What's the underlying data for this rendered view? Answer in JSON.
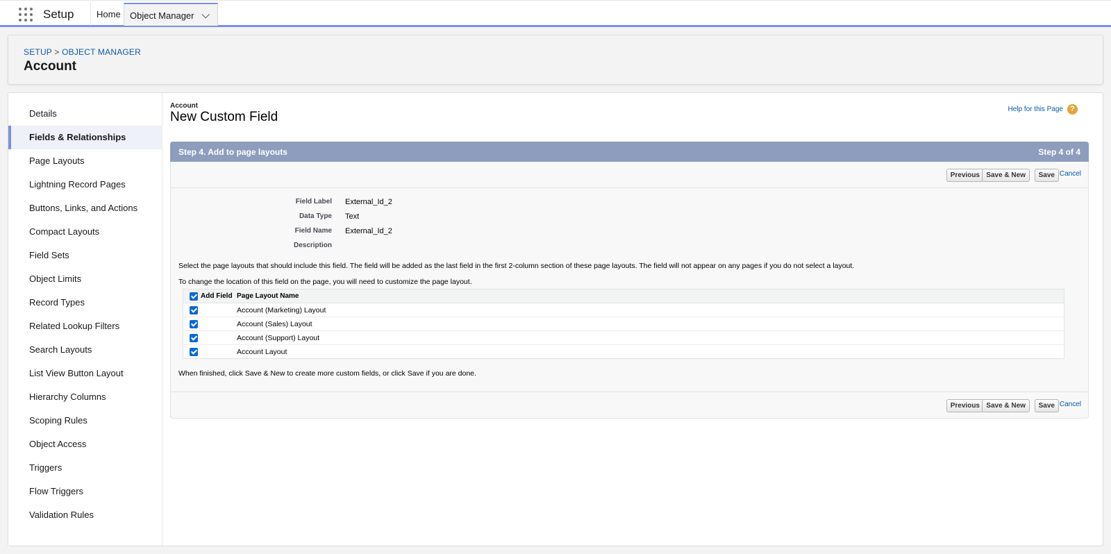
{
  "topnav": {
    "app_name": "Setup",
    "tabs": [
      {
        "label": "Home"
      },
      {
        "label": "Object Manager"
      }
    ]
  },
  "header": {
    "breadcrumb_setup": "SETUP",
    "breadcrumb_sep": " > ",
    "breadcrumb_om": "OBJECT MANAGER",
    "title": "Account"
  },
  "sidebar": {
    "items": [
      {
        "label": "Details"
      },
      {
        "label": "Fields & Relationships"
      },
      {
        "label": "Page Layouts"
      },
      {
        "label": "Lightning Record Pages"
      },
      {
        "label": "Buttons, Links, and Actions"
      },
      {
        "label": "Compact Layouts"
      },
      {
        "label": "Field Sets"
      },
      {
        "label": "Object Limits"
      },
      {
        "label": "Record Types"
      },
      {
        "label": "Related Lookup Filters"
      },
      {
        "label": "Search Layouts"
      },
      {
        "label": "List View Button Layout"
      },
      {
        "label": "Hierarchy Columns"
      },
      {
        "label": "Scoping Rules"
      },
      {
        "label": "Object Access"
      },
      {
        "label": "Triggers"
      },
      {
        "label": "Flow Triggers"
      },
      {
        "label": "Validation Rules"
      }
    ],
    "active": "Fields & Relationships"
  },
  "content": {
    "object_crumb": "Account",
    "title": "New Custom Field",
    "help_link": "Help for this Page",
    "help_icon": "?",
    "step_title": "Step 4. Add to page layouts",
    "step_count": "Step 4 of 4",
    "buttons": {
      "previous": "Previous",
      "save_new": "Save & New",
      "save": "Save",
      "cancel": "Cancel"
    },
    "details": [
      {
        "label": "Field Label",
        "value": "External_Id_2"
      },
      {
        "label": "Data Type",
        "value": "Text"
      },
      {
        "label": "Field Name",
        "value": "External_Id_2"
      },
      {
        "label": "Description",
        "value": ""
      }
    ],
    "instruction_1": "Select the page layouts that should include this field. The field will be added as the last field in the first 2-column section of these page layouts. The field will not appear on any pages if you do not select a layout.",
    "instruction_2": "To change the location of this field on the page, you will need to customize the page layout.",
    "table": {
      "col_add": "Add Field",
      "col_name": "Page Layout Name",
      "rows": [
        {
          "name": "Account (Marketing) Layout",
          "checked": true
        },
        {
          "name": "Account (Sales) Layout",
          "checked": true
        },
        {
          "name": "Account (Support) Layout",
          "checked": true
        },
        {
          "name": "Account Layout",
          "checked": true
        }
      ]
    },
    "finish_note": "When finished, click Save & New to create more custom fields, or click Save if you are done."
  },
  "colors": {
    "accent": "#7b8fe3",
    "step_bar": "#8e9dbe",
    "link": "#0b5cab",
    "checkbox": "#0b69d6",
    "help_icon": "#e8a33a"
  }
}
